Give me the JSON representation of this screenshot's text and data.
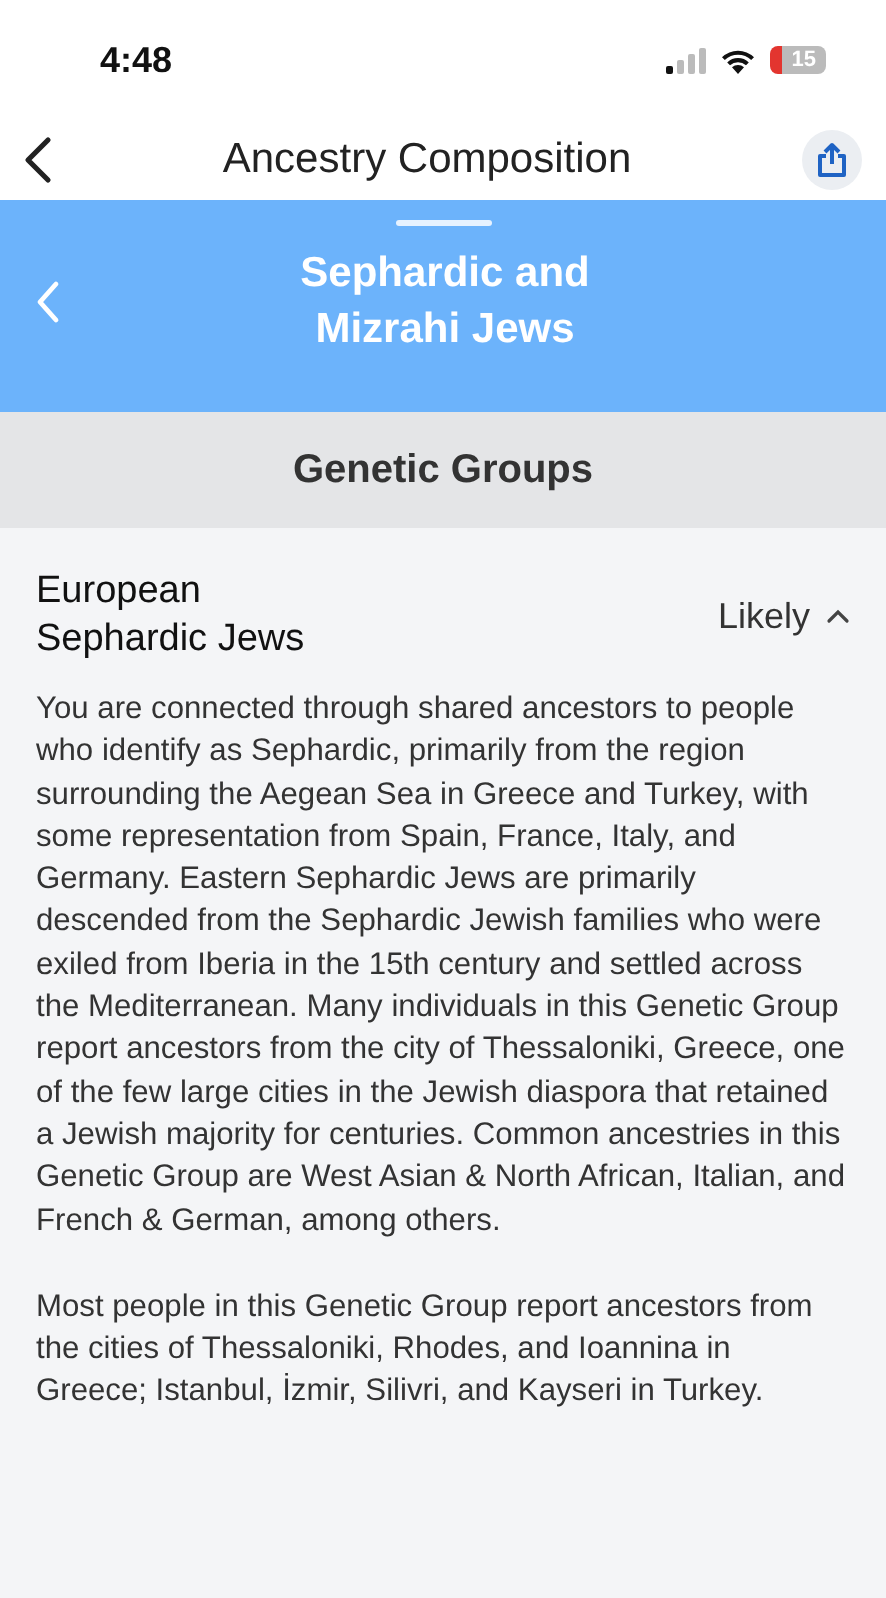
{
  "status_bar": {
    "time": "4:48",
    "battery": "15"
  },
  "nav": {
    "title": "Ancestry Composition"
  },
  "sheet": {
    "title": "Sephardic and Mizrahi Jews"
  },
  "section": {
    "title": "Genetic Groups"
  },
  "group": {
    "name": "European Sephardic Jews",
    "confidence": "Likely",
    "expanded": true,
    "paragraphs": [
      "You are connected through shared ancestors to people who identify as Sephardic, primarily from the region surrounding the Aegean Sea in Greece and Turkey, with some representation from Spain, France, Italy, and Germany. Eastern Sephardic Jews are primarily descended from the Sephardic Jewish families who were exiled from Iberia in the 15th century and settled across the Mediterranean. Many individuals in this Genetic Group report ancestors from the city of Thessaloniki, Greece, one of the few large cities in the Jewish diaspora that retained a Jewish majority for centuries. Common ancestries in this Genetic Group are West Asian & North African, Italian, and French & German, among others.",
      "Most people in this Genetic Group report ancestors from the cities of Thessaloniki, Rhodes, and Ioannina in Greece; Istanbul, İzmir, Silivri, and Kayseri in Turkey."
    ]
  }
}
